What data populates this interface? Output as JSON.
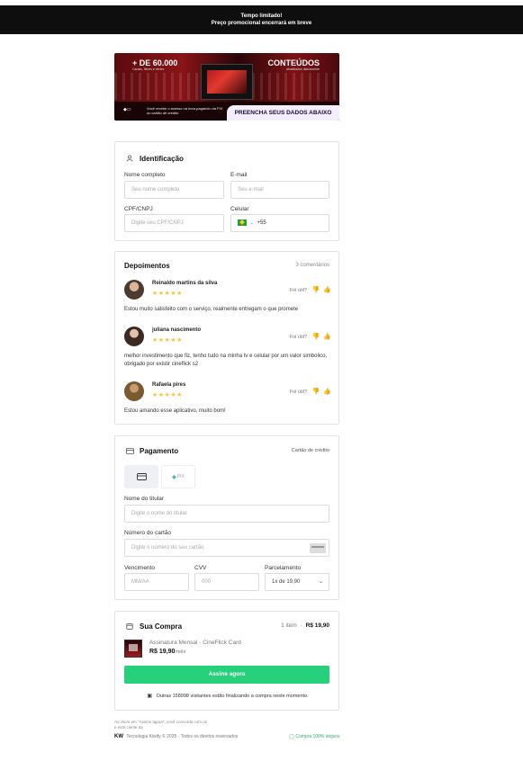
{
  "topbar": {
    "line1": "Tempo limitado!",
    "line2": "Preço promocional encerrará em breve"
  },
  "banner": {
    "left_title": "+ DE 60.000",
    "left_sub": "Canais, filmes e séries",
    "right_title": "CONTEÚDOS",
    "right_sub": "atualizados diariamente",
    "note": "Você recebe o acesso na hora pagando via PIX ou cartão de crédito",
    "cta": "PREENCHA SEUS DADOS ABAIXO",
    "brand_color": "#8a1418"
  },
  "identification": {
    "title": "Identificação",
    "icon": "user-icon",
    "name_label": "Nome completo",
    "name_placeholder": "Seu nome completo",
    "email_label": "E-mail",
    "email_placeholder": "Seu e-mail",
    "cpf_label": "CPF/CNPJ",
    "cpf_placeholder": "Digite seu CPF/CNPJ",
    "phone_label": "Celular",
    "phone_prefix": "+55",
    "phone_flag": "brazil-flag-icon"
  },
  "testimonials": {
    "title": "Depoimentos",
    "count": "3 comentários",
    "useful_label": "Foi útil?",
    "items": [
      {
        "name": "Reinaldo martins da silva",
        "stars": "★★★★★",
        "text": "Estou muito satisfeito com o serviço, realmente entregam o que promete"
      },
      {
        "name": "juliana nascimento",
        "stars": "★★★★★",
        "text": "melhor investimento que fiz, tenho tudo na minha tv e celular por um valor simbolico, obrigado por existir cineflick s2"
      },
      {
        "name": "Rafaela pires",
        "stars": "★★★★★",
        "text": "Estou amando esse aplicativo, muito bom!"
      }
    ]
  },
  "payment": {
    "title": "Pagamento",
    "method_label": "Cartão de crédito",
    "pix_label": "PIX",
    "holder_label": "Nome do titular",
    "holder_placeholder": "Digite o nome do titular",
    "card_label": "Número do cartão",
    "card_placeholder": "Digite o número do seu cartão",
    "expiry_label": "Vencimento",
    "expiry_placeholder": "MM/AA",
    "cvv_label": "CVV",
    "cvv_placeholder": "000",
    "installments_label": "Parcelamento",
    "installments_value": "1x de 19,90"
  },
  "purchase": {
    "title": "Sua Compra",
    "items_count": "1 item",
    "total": "R$ 19,90",
    "product_name": "Assinatura Mensal - CineFlick Card",
    "product_price": "R$ 19,90",
    "product_period": "/mês",
    "submit_label": "Assine agora",
    "visitors_note": "Outras 158998 visitantes estão finalizando a compra neste momento.",
    "accent_color": "#27d07a"
  },
  "footer": {
    "terms_line1": "Ao clicar em \"Assine agora\", você concorda com os",
    "terms_line2": "e está ciente da",
    "brand": "Tecnologia Kiwify © 2025 - Todos os direitos reservados",
    "secure": "Compra 100% segura"
  }
}
